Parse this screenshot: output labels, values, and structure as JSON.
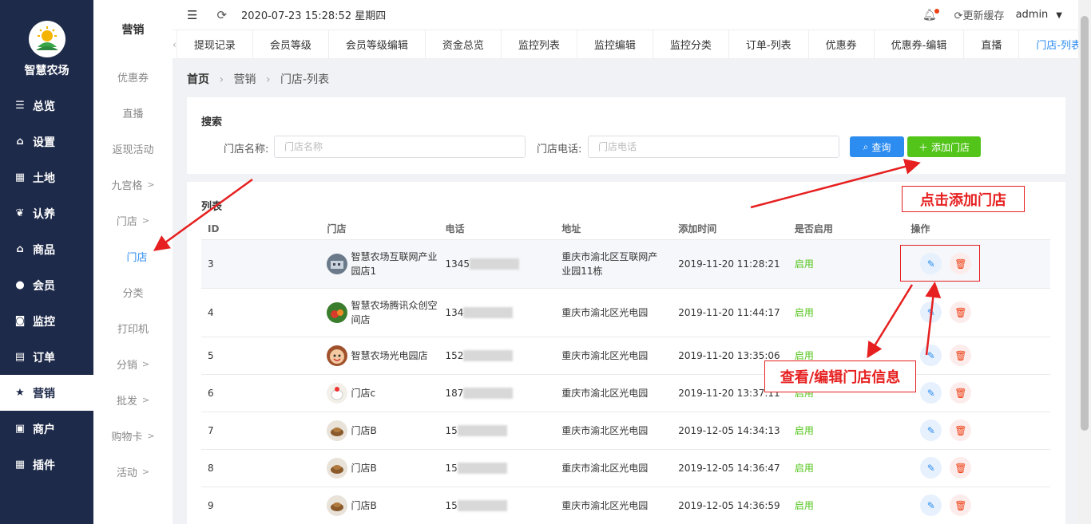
{
  "app": {
    "name": "智慧农场"
  },
  "sidebar": {
    "items": [
      {
        "label": "总览",
        "icon": "sliders-icon"
      },
      {
        "label": "设置",
        "icon": "bag-icon"
      },
      {
        "label": "土地",
        "icon": "grid-icon"
      },
      {
        "label": "认养",
        "icon": "tree-icon"
      },
      {
        "label": "商品",
        "icon": "bag-icon"
      },
      {
        "label": "会员",
        "icon": "user-icon"
      },
      {
        "label": "监控",
        "icon": "camera-icon"
      },
      {
        "label": "订单",
        "icon": "list-icon"
      },
      {
        "label": "营销",
        "icon": "star-icon",
        "active": true
      },
      {
        "label": "商户",
        "icon": "shop-icon"
      },
      {
        "label": "插件",
        "icon": "grid-icon"
      }
    ]
  },
  "subsidebar": {
    "title": "营销",
    "items": [
      {
        "label": "优惠券"
      },
      {
        "label": "直播"
      },
      {
        "label": "返现活动"
      },
      {
        "label": "九宫格",
        "arrow": ">"
      },
      {
        "label": "门店",
        "arrow": ">"
      },
      {
        "label": "门店",
        "active": true
      },
      {
        "label": "分类"
      },
      {
        "label": "打印机"
      },
      {
        "label": "分销",
        "arrow": ">"
      },
      {
        "label": "批发",
        "arrow": ">"
      },
      {
        "label": "购物卡",
        "arrow": ">"
      },
      {
        "label": "活动",
        "arrow": ">"
      }
    ]
  },
  "header": {
    "datetime": "2020-07-23 15:28:52 星期四",
    "update_cache": "更新缓存",
    "user": "admin"
  },
  "tabs": [
    {
      "label": "提现记录"
    },
    {
      "label": "会员等级"
    },
    {
      "label": "会员等级编辑"
    },
    {
      "label": "资金总览"
    },
    {
      "label": "监控列表"
    },
    {
      "label": "监控编辑"
    },
    {
      "label": "监控分类"
    },
    {
      "label": "订单-列表"
    },
    {
      "label": "优惠券"
    },
    {
      "label": "优惠券-编辑"
    },
    {
      "label": "直播"
    },
    {
      "label": "门店-列表",
      "active": true
    }
  ],
  "breadcrumb": {
    "home": "首页",
    "section": "营销",
    "page": "门店-列表"
  },
  "search": {
    "title": "搜索",
    "name_label": "门店名称:",
    "name_placeholder": "门店名称",
    "phone_label": "门店电话:",
    "phone_placeholder": "门店电话",
    "query_button": "查询",
    "add_button": "添加门店"
  },
  "list": {
    "title": "列表",
    "columns": [
      "ID",
      "门店",
      "电话",
      "地址",
      "添加时间",
      "是否启用",
      "操作"
    ],
    "rows": [
      {
        "id": "3",
        "store": "智慧农场互联网产业园店1",
        "phone": "1345",
        "address": "重庆市渝北区互联网产业园11栋",
        "time": "2019-11-20 11:28:21",
        "status": "启用",
        "avatar": "building"
      },
      {
        "id": "4",
        "store": "智慧农场腾讯众创空间店",
        "phone": "134",
        "address": "重庆市渝北区光电园",
        "time": "2019-11-20 11:44:17",
        "status": "启用",
        "avatar": "fruit"
      },
      {
        "id": "5",
        "store": "智慧农场光电园店",
        "phone": "152",
        "address": "重庆市渝北区光电园",
        "time": "2019-11-20 13:35:06",
        "status": "启用",
        "avatar": "face"
      },
      {
        "id": "6",
        "store": "门店c",
        "phone": "187",
        "address": "重庆市渝北区光电园",
        "time": "2019-11-20 13:37:11",
        "status": "启用",
        "avatar": "bird"
      },
      {
        "id": "7",
        "store": "门店B",
        "phone": "15",
        "address": "重庆市渝北区光电园",
        "time": "2019-12-05 14:34:13",
        "status": "启用",
        "avatar": "dish"
      },
      {
        "id": "8",
        "store": "门店B",
        "phone": "15",
        "address": "重庆市渝北区光电园",
        "time": "2019-12-05 14:36:47",
        "status": "启用",
        "avatar": "dish"
      },
      {
        "id": "9",
        "store": "门店B",
        "phone": "15",
        "address": "重庆市渝北区光电园",
        "time": "2019-12-05 14:36:59",
        "status": "启用",
        "avatar": "dish"
      }
    ]
  },
  "annotations": {
    "add_store": "点击添加门店",
    "view_edit": "查看/编辑门店信息"
  },
  "colors": {
    "sidebar": "#1e2a4a",
    "primary": "#2d8cf0",
    "success": "#52c41a",
    "danger": "#ed4014",
    "annotation": "#e62020"
  }
}
